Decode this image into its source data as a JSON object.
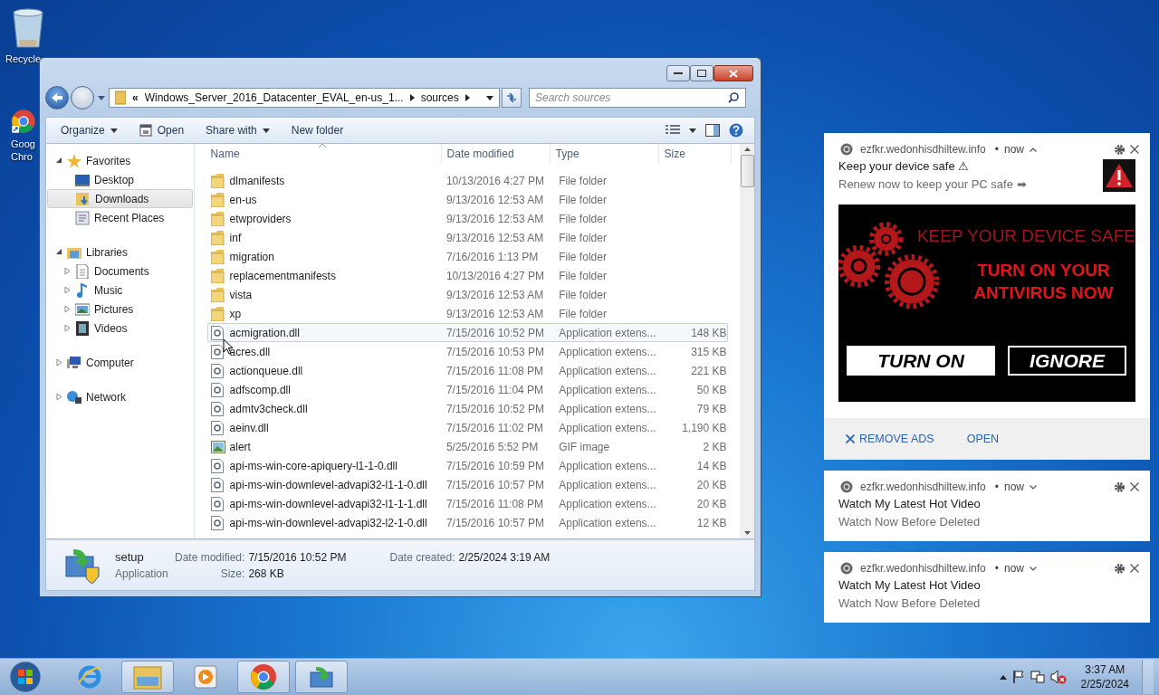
{
  "desktop_icons": [
    {
      "kind": "recycle",
      "lines": [
        "Recycle"
      ]
    },
    {
      "kind": "chrome",
      "lines": [
        "Goog",
        "Chro"
      ]
    }
  ],
  "explorer": {
    "breadcrumb": [
      "«",
      "Windows_Server_2016_Datacenter_EVAL_en-us_1...",
      "sources"
    ],
    "search_placeholder": "Search sources",
    "commands": [
      {
        "label": "Organize",
        "kind": "menu"
      },
      {
        "label": "Open",
        "kind": "open"
      },
      {
        "label": "Share with",
        "kind": "menu"
      },
      {
        "label": "New folder",
        "kind": "plain"
      }
    ],
    "nav": [
      {
        "label": "Favorites",
        "kind": "star",
        "expanded": true,
        "selected": false,
        "children": [
          {
            "label": "Desktop",
            "kind": "desktop",
            "selected": false
          },
          {
            "label": "Downloads",
            "kind": "downloads",
            "selected": true
          },
          {
            "label": "Recent Places",
            "kind": "recent",
            "selected": false
          }
        ]
      },
      {
        "label": "Libraries",
        "kind": "libraries",
        "expanded": true,
        "selected": false,
        "children": [
          {
            "label": "Documents",
            "kind": "documents",
            "expanded": false,
            "selected": false
          },
          {
            "label": "Music",
            "kind": "music",
            "expanded": false,
            "selected": false
          },
          {
            "label": "Pictures",
            "kind": "pictures",
            "expanded": false,
            "selected": false
          },
          {
            "label": "Videos",
            "kind": "videos",
            "expanded": false,
            "selected": false
          }
        ]
      },
      {
        "label": "Computer",
        "kind": "computer",
        "expanded": false,
        "selected": false
      },
      {
        "label": "Network",
        "kind": "network",
        "expanded": false,
        "selected": false
      }
    ],
    "columns": [
      "Name",
      "Date modified",
      "Type",
      "Size"
    ],
    "rows": [
      {
        "name": "dlmanifests",
        "date": "10/13/2016 4:27 PM",
        "type": "File folder",
        "kind": "folder",
        "hovered": false
      },
      {
        "name": "en-us",
        "date": "9/13/2016 12:53 AM",
        "type": "File folder",
        "kind": "folder",
        "hovered": false
      },
      {
        "name": "etwproviders",
        "date": "9/13/2016 12:53 AM",
        "type": "File folder",
        "kind": "folder",
        "hovered": false
      },
      {
        "name": "inf",
        "date": "9/13/2016 12:53 AM",
        "type": "File folder",
        "kind": "folder",
        "hovered": false
      },
      {
        "name": "migration",
        "date": "7/16/2016 1:13 PM",
        "type": "File folder",
        "kind": "folder",
        "hovered": false
      },
      {
        "name": "replacementmanifests",
        "date": "10/13/2016 4:27 PM",
        "type": "File folder",
        "kind": "folder",
        "hovered": false
      },
      {
        "name": "vista",
        "date": "9/13/2016 12:53 AM",
        "type": "File folder",
        "kind": "folder",
        "hovered": false
      },
      {
        "name": "xp",
        "date": "9/13/2016 12:53 AM",
        "type": "File folder",
        "kind": "folder",
        "hovered": false
      },
      {
        "name": "acmigration.dll",
        "date": "7/15/2016 10:52 PM",
        "type": "Application extens...",
        "size": "148 KB",
        "kind": "dll",
        "hovered": true
      },
      {
        "name": "acres.dll",
        "date": "7/15/2016 10:53 PM",
        "type": "Application extens...",
        "size": "315 KB",
        "kind": "dll",
        "hovered": false
      },
      {
        "name": "actionqueue.dll",
        "date": "7/15/2016 11:08 PM",
        "type": "Application extens...",
        "size": "221 KB",
        "kind": "dll",
        "hovered": false
      },
      {
        "name": "adfscomp.dll",
        "date": "7/15/2016 11:04 PM",
        "type": "Application extens...",
        "size": "50 KB",
        "kind": "dll",
        "hovered": false
      },
      {
        "name": "admtv3check.dll",
        "date": "7/15/2016 10:52 PM",
        "type": "Application extens...",
        "size": "79 KB",
        "kind": "dll",
        "hovered": false
      },
      {
        "name": "aeinv.dll",
        "date": "7/15/2016 11:02 PM",
        "type": "Application extens...",
        "size": "1,190 KB",
        "kind": "dll",
        "hovered": false
      },
      {
        "name": "alert",
        "date": "5/25/2016 5:52 PM",
        "type": "GIF image",
        "size": "2 KB",
        "kind": "gif",
        "hovered": false
      },
      {
        "name": "api-ms-win-core-apiquery-l1-1-0.dll",
        "date": "7/15/2016 10:59 PM",
        "type": "Application extens...",
        "size": "14 KB",
        "kind": "dll",
        "hovered": false
      },
      {
        "name": "api-ms-win-downlevel-advapi32-l1-1-0.dll",
        "date": "7/15/2016 10:57 PM",
        "type": "Application extens...",
        "size": "20 KB",
        "kind": "dll",
        "hovered": false
      },
      {
        "name": "api-ms-win-downlevel-advapi32-l1-1-1.dll",
        "date": "7/15/2016 11:08 PM",
        "type": "Application extens...",
        "size": "20 KB",
        "kind": "dll",
        "hovered": false
      },
      {
        "name": "api-ms-win-downlevel-advapi32-l2-1-0.dll",
        "date": "7/15/2016 10:57 PM",
        "type": "Application extens...",
        "size": "12 KB",
        "kind": "dll",
        "hovered": false
      }
    ],
    "details": {
      "name": "setup",
      "type": "Application",
      "fields": [
        {
          "label": "Date modified:",
          "value": "7/15/2016 10:52 PM"
        },
        {
          "label": "Date created:",
          "value": "2/25/2024 3:19 AM"
        },
        {
          "label": "Size:",
          "value": "268 KB"
        }
      ]
    }
  },
  "notifications": [
    {
      "site": "ezfkr.wedonhisdhiltew.info",
      "dot": "•",
      "time": "now",
      "expanded": true,
      "title": "Keep your device safe ⚠",
      "body": "Renew now to keep your PC safe ➡",
      "banner": {
        "tagline": "KEEP YOUR DEVICE SAFE",
        "headline": [
          "TURN ON YOUR",
          "ANTIVIRUS NOW"
        ],
        "buttons": [
          {
            "label": "TURN ON",
            "kind": "primary"
          },
          {
            "label": "IGNORE",
            "kind": "outline"
          }
        ]
      },
      "actions": [
        {
          "label": "REMOVE ADS",
          "kind": "dismiss"
        },
        {
          "label": "OPEN",
          "kind": "plain"
        }
      ]
    },
    {
      "site": "ezfkr.wedonhisdhiltew.info",
      "dot": "•",
      "time": "now",
      "expanded": false,
      "title": "Watch My Latest Hot Video",
      "body": "Watch Now Before Deleted"
    },
    {
      "site": "ezfkr.wedonhisdhiltew.info",
      "dot": "•",
      "time": "now",
      "expanded": false,
      "title": "Watch My Latest Hot Video",
      "body": "Watch Now Before Deleted"
    }
  ],
  "taskbar": {
    "apps": [
      {
        "kind": "ie",
        "open": false
      },
      {
        "kind": "explorer",
        "open": true
      },
      {
        "kind": "media",
        "open": false
      },
      {
        "kind": "chrome",
        "open": true
      },
      {
        "kind": "setup",
        "open": true
      }
    ],
    "volume_muted": true,
    "time": "3:37 AM",
    "date": "2/25/2024"
  }
}
